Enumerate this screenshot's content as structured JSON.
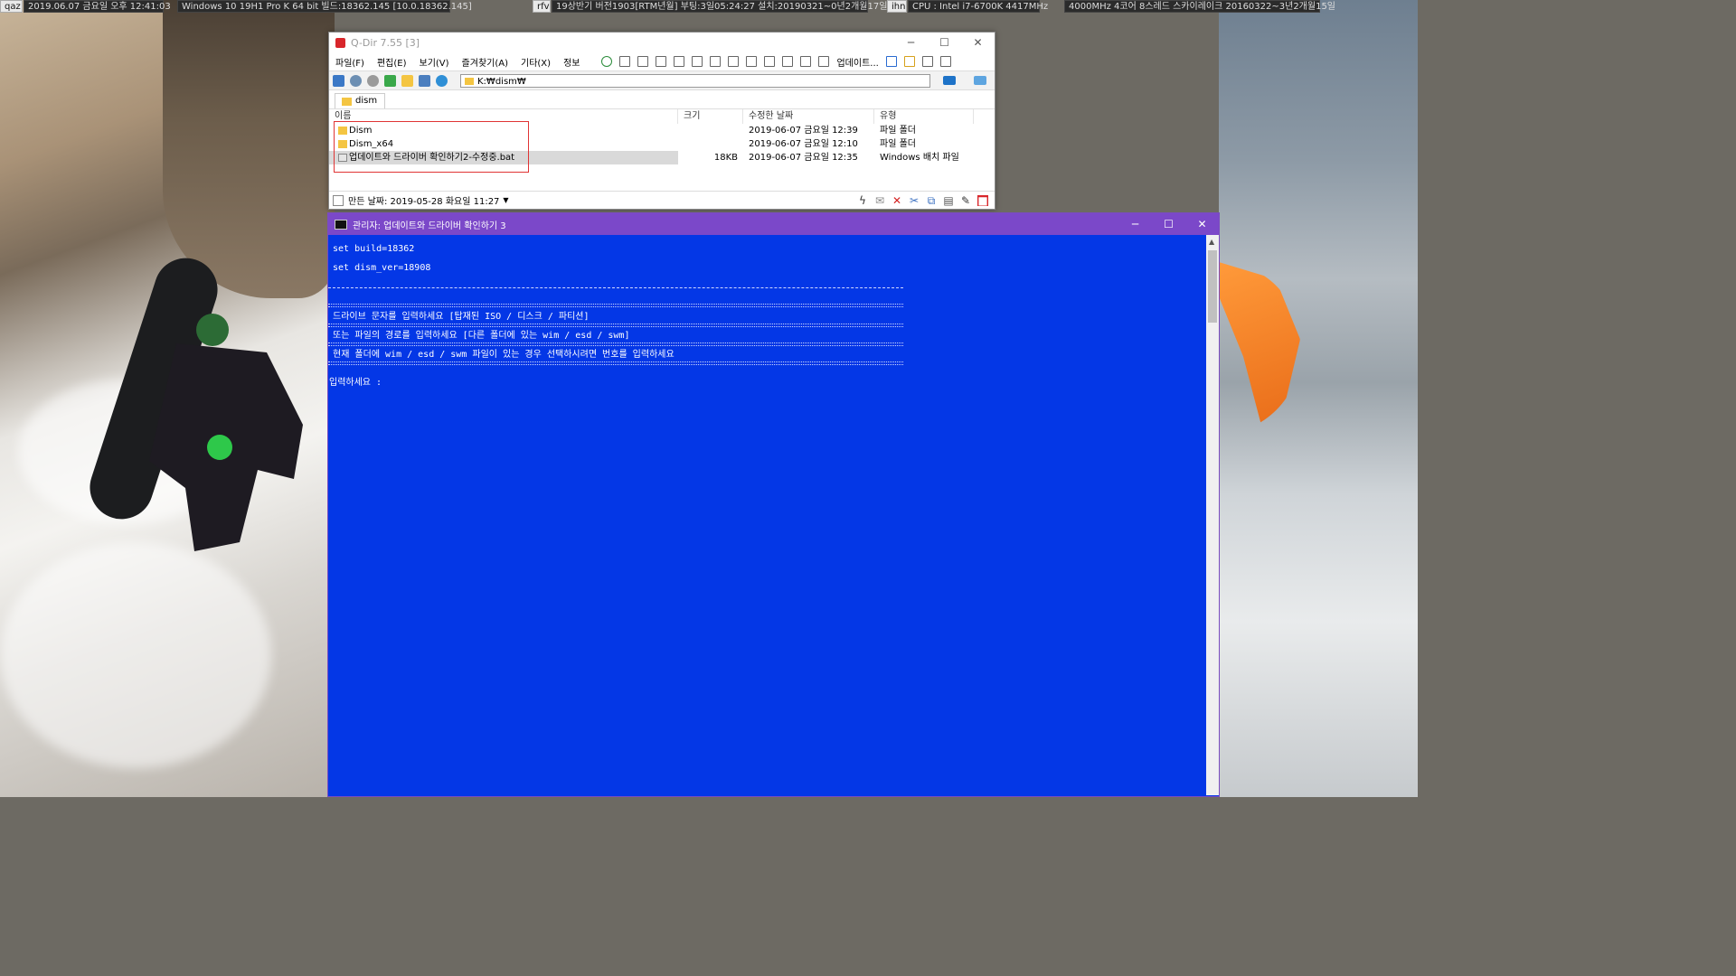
{
  "topbar": {
    "chips": [
      {
        "id": "qaz",
        "text": "qaz"
      },
      {
        "id": "datetime",
        "text": "2019.06.07 금요일 오후 12:41:03"
      },
      {
        "id": "os",
        "text": "Windows 10 19H1 Pro K 64 bit 빌드:18362.145 [10.0.18362.145]"
      },
      {
        "id": "rfv",
        "text": "rfv"
      },
      {
        "id": "version",
        "text": "19상반기 버전1903[RTM년월]  부팅:3일05:24:27 설치:20190321~0년2개월17일"
      },
      {
        "id": "ihn",
        "text": "ihn"
      },
      {
        "id": "cpu",
        "text": "CPU : Intel i7-6700K 4417MHz"
      },
      {
        "id": "cpuinfo",
        "text": "4000MHz 4코어 8스레드 스카이레이크 20160322~3년2개월15일"
      }
    ]
  },
  "qdir": {
    "title": "Q-Dir 7.55 [3]",
    "menu": [
      "파일(F)",
      "편집(E)",
      "보기(V)",
      "즐겨찾기(A)",
      "기타(X)",
      "정보"
    ],
    "update_label": "업데이트...",
    "address": "K:₩dism₩",
    "tab": "dism",
    "columns": {
      "name": "이름",
      "size": "크기",
      "modified": "수정한 날짜",
      "type": "유형"
    },
    "rows": [
      {
        "name": "Dism",
        "size": "",
        "modified": "2019-06-07 금요일 12:39",
        "type": "파일 폴더",
        "kind": "folder"
      },
      {
        "name": "Dism_x64",
        "size": "",
        "modified": "2019-06-07 금요일 12:10",
        "type": "파일 폴더",
        "kind": "folder"
      },
      {
        "name": "업데이트와 드라이버 확인하기2-수정중.bat",
        "size": "18KB",
        "modified": "2019-06-07 금요일 12:35",
        "type": "Windows 배치 파일",
        "kind": "bat"
      }
    ],
    "status": "만든 날짜: 2019-05-28 화요일 11:27"
  },
  "console": {
    "title": "관리자:  업데이트와 드라이버 확인하기 3",
    "lines": {
      "build": "set build=18362",
      "dism": "set dism_ver=18908",
      "prompt1": "드라이브 문자를 입력하세요 [탑재된 ISO / 디스크 / 파티션]",
      "prompt2": "또는 파일의 경로를 입력하세요 [다른 폴더에 있는 wim / esd / swm]",
      "prompt3": "현재 폴더에 wim / esd / swm 파일이 있는 경우 선택하시려면 번호를 입력하세요",
      "input": "입력하세요 :"
    }
  },
  "colors": {
    "console_bg": "#0437e6",
    "console_title": "#7b48c9",
    "highlight_box": "#e03434"
  }
}
